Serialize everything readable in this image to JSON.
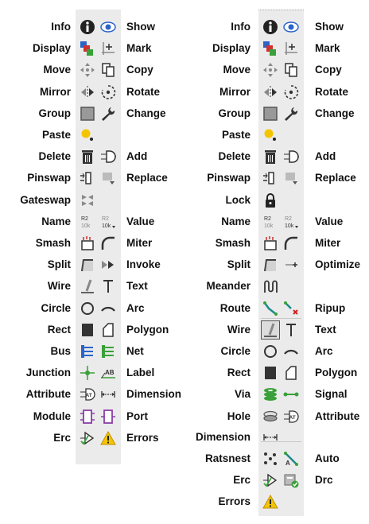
{
  "left": {
    "labels_left": [
      "Info",
      "Display",
      "Move",
      "Mirror",
      "Group",
      "Paste",
      "Delete",
      "Pinswap",
      "Gateswap",
      "Name",
      "Smash",
      "Split",
      "Wire",
      "Circle",
      "Rect",
      "Bus",
      "Junction",
      "Attribute",
      "Module",
      "Erc"
    ],
    "labels_right": [
      "Show",
      "Mark",
      "Copy",
      "Rotate",
      "Change",
      "",
      "Add",
      "Replace",
      "",
      "Value",
      "Miter",
      "Invoke",
      "Text",
      "Arc",
      "Polygon",
      "Net",
      "Label",
      "Dimension",
      "Port",
      "Errors"
    ],
    "icons_left": [
      "info-icon",
      "display-icon",
      "move-icon",
      "mirror-icon",
      "group-icon",
      "paste-icon",
      "delete-icon",
      "pinswap-icon",
      "gateswap-icon",
      "name-icon",
      "smash-icon",
      "split-icon",
      "wire-icon",
      "circle-icon",
      "rect-icon",
      "bus-icon",
      "junction-icon",
      "attribute-icon",
      "module-icon",
      "erc-icon"
    ],
    "icons_right": [
      "show-icon",
      "mark-icon",
      "copy-icon",
      "rotate-icon",
      "change-icon",
      "",
      "add-icon",
      "replace-icon",
      "",
      "value-icon",
      "miter-icon",
      "invoke-icon",
      "text-icon",
      "arc-icon",
      "polygon-icon",
      "net-icon",
      "label-icon",
      "dimension-icon",
      "port-icon",
      "errors-icon"
    ]
  },
  "right": {
    "labels_left": [
      "Info",
      "Display",
      "Move",
      "Mirror",
      "Group",
      "Paste",
      "Delete",
      "Pinswap",
      "Lock",
      "Name",
      "Smash",
      "Split",
      "Meander",
      "Route",
      "Wire",
      "Circle",
      "Rect",
      "Via",
      "Hole",
      "Dimension",
      "Ratsnest",
      "Erc",
      "Errors"
    ],
    "labels_right": [
      "Show",
      "Mark",
      "Copy",
      "Rotate",
      "Change",
      "",
      "Add",
      "Replace",
      "",
      "Value",
      "Miter",
      "Optimize",
      "",
      "Ripup",
      "Text",
      "Arc",
      "Polygon",
      "Signal",
      "Attribute",
      "",
      "Auto",
      "Drc",
      ""
    ],
    "icons_left": [
      "info-icon",
      "display-icon",
      "move-icon",
      "mirror-icon",
      "group-icon",
      "paste-icon",
      "delete-icon",
      "pinswap-icon",
      "lock-icon",
      "name-icon",
      "smash-icon",
      "split-icon",
      "meander-icon",
      "route-icon",
      "wire-icon",
      "circle-icon",
      "rect-icon",
      "via-icon",
      "hole-icon",
      "dimension-icon",
      "ratsnest-icon",
      "erc-icon",
      "errors-icon"
    ],
    "icons_right": [
      "show-icon",
      "mark-icon",
      "copy-icon",
      "rotate-icon",
      "change-icon",
      "",
      "add-icon",
      "replace-icon",
      "",
      "value-icon",
      "miter-icon",
      "optimize-icon",
      "",
      "ripup-icon",
      "text-icon",
      "arc-icon",
      "polygon-icon",
      "signal-icon",
      "attribute-icon",
      "",
      "auto-icon",
      "drc-icon",
      ""
    ]
  },
  "icon_text": {
    "name": "R2\n10k",
    "value": "R2\n10k",
    "label": "AB",
    "attribute": "AT",
    "auto": "A"
  },
  "colors": {
    "toolbar_bg": "#ebebeb",
    "accent_blue": "#2a64c8",
    "green": "#3aa03a",
    "warning": "#f5c400"
  }
}
